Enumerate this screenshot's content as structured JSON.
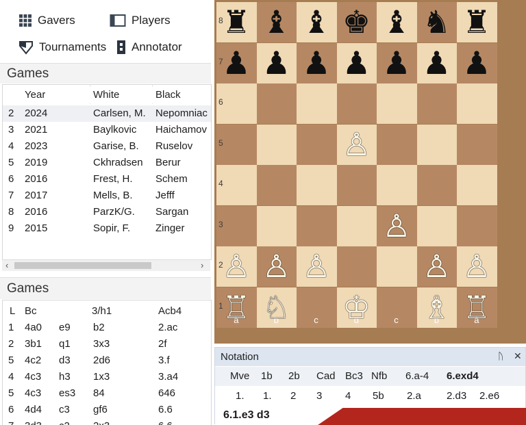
{
  "nav": {
    "gavers": "Gavers",
    "players": "Players",
    "tournaments": "Tournaments",
    "annotator": "Annotator"
  },
  "games_section": {
    "title": "Games",
    "headers": [
      "Year",
      "White",
      "Black"
    ],
    "rows": [
      {
        "n": "2",
        "year": "2024",
        "white": "Carlsen, M.",
        "black": "Nepomniac"
      },
      {
        "n": "3",
        "year": "2021",
        "white": "Baylkovic",
        "black": "Haichamov"
      },
      {
        "n": "4",
        "year": "2023",
        "white": "Garise, B.",
        "black": "Ruselov"
      },
      {
        "n": "5",
        "year": "2019",
        "white": "Ckhradsen",
        "black": "Berur"
      },
      {
        "n": "6",
        "year": "2016",
        "white": "Frest, H.",
        "black": "Schem"
      },
      {
        "n": "7",
        "year": "2017",
        "white": "Mells, B.",
        "black": "Jefff"
      },
      {
        "n": "8",
        "year": "2016",
        "white": "ParzK/G.",
        "black": "Sargan"
      },
      {
        "n": "9",
        "year": "2015",
        "white": "Sopir, F.",
        "black": "Zinger"
      }
    ],
    "scroll_left": "‹",
    "scroll_right": "›"
  },
  "games2_section": {
    "title": "Games",
    "headers": [
      "L",
      "Bc",
      "",
      "3/h1",
      "Acb4"
    ],
    "rows": [
      [
        "1",
        "4a0",
        "e9",
        "b2",
        "2.ac"
      ],
      [
        "2",
        "3b1",
        "q1",
        "3x3",
        "2f"
      ],
      [
        "5",
        "4c2",
        "d3",
        "2d6",
        "3.f"
      ],
      [
        "4",
        "4c3",
        "h3",
        "1x3",
        "3.a4"
      ],
      [
        "5",
        "4c3",
        "es3",
        "84",
        "646"
      ],
      [
        "6",
        "4d4",
        "c3",
        "gf6",
        "6.6"
      ],
      [
        "7",
        "3d3",
        "c2",
        "2x3",
        "6.6"
      ]
    ]
  },
  "board": {
    "ranks": [
      "8",
      "7",
      "6",
      "5",
      "4",
      "3",
      "2",
      "1"
    ],
    "files": [
      "a",
      "b",
      "c",
      "d",
      "c",
      "b",
      "â"
    ],
    "file_labels_shown": [
      "à",
      "b",
      "c",
      "d",
      "c",
      "b",
      "â"
    ],
    "pieces": [
      {
        "sq": "a8",
        "piece": "rook",
        "color": "black"
      },
      {
        "sq": "b8",
        "piece": "bishop",
        "color": "black"
      },
      {
        "sq": "c8",
        "piece": "bishop",
        "color": "black"
      },
      {
        "sq": "d8",
        "piece": "king",
        "color": "black"
      },
      {
        "sq": "e8",
        "piece": "bishop",
        "color": "black"
      },
      {
        "sq": "f8",
        "piece": "knight",
        "color": "black"
      },
      {
        "sq": "g8",
        "piece": "rook",
        "color": "black"
      },
      {
        "sq": "a7",
        "piece": "pawn",
        "color": "black"
      },
      {
        "sq": "b7",
        "piece": "pawn",
        "color": "black"
      },
      {
        "sq": "c7",
        "piece": "pawn",
        "color": "black"
      },
      {
        "sq": "d7",
        "piece": "pawn",
        "color": "black"
      },
      {
        "sq": "e7",
        "piece": "pawn",
        "color": "black"
      },
      {
        "sq": "f7",
        "piece": "pawn",
        "color": "black"
      },
      {
        "sq": "g7",
        "piece": "pawn",
        "color": "black"
      },
      {
        "sq": "d5",
        "piece": "pawn",
        "color": "white"
      },
      {
        "sq": "e3",
        "piece": "pawn",
        "color": "white"
      },
      {
        "sq": "a2",
        "piece": "pawn",
        "color": "white"
      },
      {
        "sq": "b2",
        "piece": "pawn",
        "color": "white"
      },
      {
        "sq": "c2",
        "piece": "pawn",
        "color": "white"
      },
      {
        "sq": "f2",
        "piece": "pawn",
        "color": "white"
      },
      {
        "sq": "g2",
        "piece": "pawn",
        "color": "white"
      },
      {
        "sq": "a1",
        "piece": "rook",
        "color": "white"
      },
      {
        "sq": "b1",
        "piece": "knight",
        "color": "white"
      },
      {
        "sq": "d1",
        "piece": "king",
        "color": "white"
      },
      {
        "sq": "f1",
        "piece": "bishop",
        "color": "white"
      },
      {
        "sq": "g1",
        "piece": "rook",
        "color": "white"
      }
    ]
  },
  "notation": {
    "title": "Notation",
    "pin_icon": "ᚢ",
    "close_icon": "✕",
    "head": [
      "Mve",
      "1b",
      "2b",
      "Cad",
      "Bc3",
      "Nfb",
      "6.a-4",
      "6.exd4"
    ],
    "row": [
      "1.",
      "1.",
      "2",
      "3",
      "4",
      "5b",
      "2.a",
      "2.d3",
      "2.e6"
    ],
    "current": "6.1.e3   d3"
  },
  "colors": {
    "light_square": "#f0d9b5",
    "dark_square": "#b58863",
    "board_frame": "#a67c52",
    "notation_title": "#dde5f0",
    "accent_red": "#b3261e"
  }
}
